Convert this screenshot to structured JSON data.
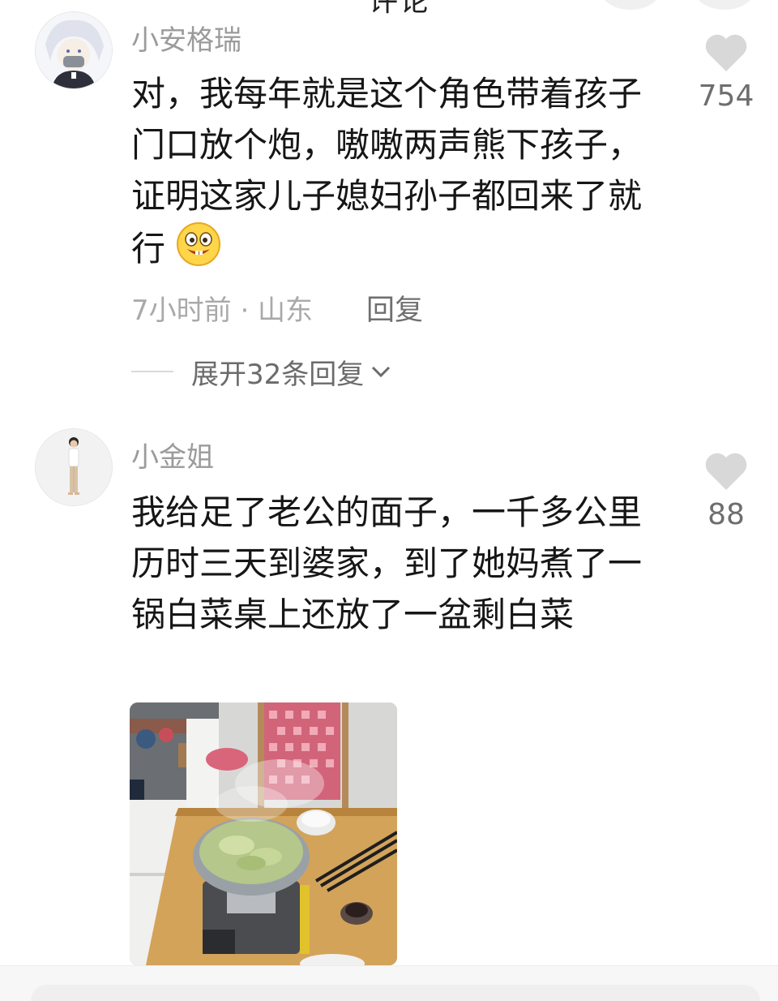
{
  "comments": [
    {
      "username": "小安格瑞",
      "text": "对，我每年就是这个角色带着孩子门口放个炮，嗷嗷两声熊下孩子，证明这家儿子媳妇孙子都回来了就行",
      "emoji": "grinning-face-emoji",
      "likes": "754",
      "time_location": "7小时前 · 山东",
      "reply_label": "回复",
      "expand_label": "展开32条回复"
    },
    {
      "username": "小金姐",
      "text": "我给足了老公的面子，一千多公里历时三天到婆家，到了她妈煮了一锅白菜桌上还放了一盆剩白菜",
      "likes": "88",
      "image": "photo-pot-of-cabbage"
    }
  ],
  "colors": {
    "username": "#9b9b9b",
    "text": "#161616",
    "meta": "#a9a9a9",
    "heart": "#d8d8d8"
  }
}
